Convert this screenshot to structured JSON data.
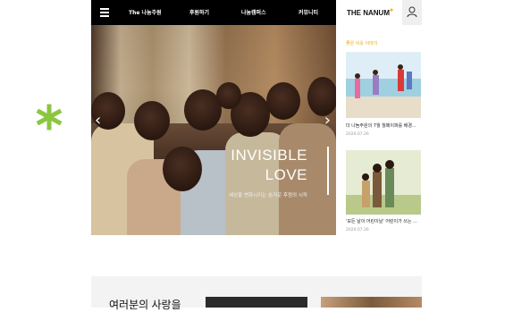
{
  "nav": {
    "links": [
      "The 나눔주원",
      "후원하기",
      "나눔캠퍼스",
      "커뮤니티"
    ]
  },
  "hero": {
    "title_line1": "INVISIBLE",
    "title_line2": "LOVE",
    "subtitle": "세상을 변화시키는 숨겨운 후원의 시작",
    "prev_arrow": "‹",
    "next_arrow": "›"
  },
  "brand": {
    "name": "THE NANUM",
    "accent_color": "#f5b400"
  },
  "side": {
    "section_label": "좋은 이웃 이야기",
    "cards": [
      {
        "title": "더 나눔주원의 7월 월페이퍼를 배경...",
        "date": "2024.07.26"
      },
      {
        "title": "'모든 날이 어린이날' 어린이가 쓰는 ...",
        "date": "2024.07.26"
      }
    ]
  },
  "bottom": {
    "title": "여러분의 사랑을"
  },
  "icons": {
    "menu": "hamburger-icon",
    "user": "user-icon",
    "decor": "asterisk-icon"
  },
  "colors": {
    "nav_bg": "#000000",
    "decor_green": "#8cc63f",
    "section_label": "#e8a400"
  }
}
